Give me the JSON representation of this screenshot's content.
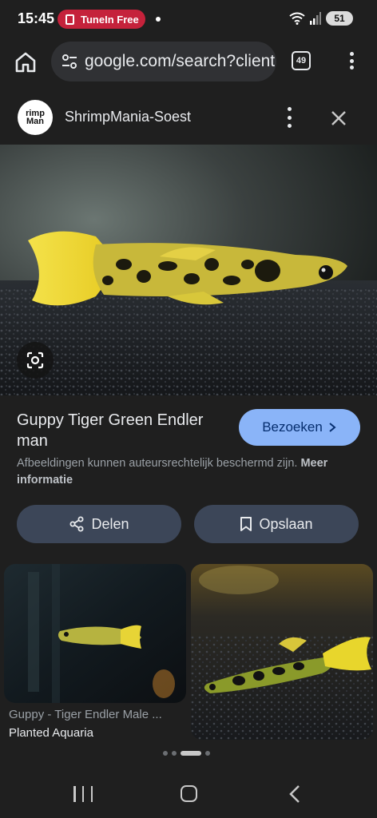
{
  "status_bar": {
    "time": "15:45",
    "recording_pill": "TuneIn Free",
    "battery": "51"
  },
  "browser": {
    "url": "google.com/search?client",
    "tab_count": "49"
  },
  "source": {
    "logo_line1": "rimp",
    "logo_line2": "Man",
    "name": "ShrimpMania-Soest"
  },
  "result": {
    "title": "Guppy Tiger Green Endler man",
    "visit_label": "Bezoeken",
    "disclaimer": "Afbeeldingen kunnen auteursrechtelijk beschermd zijn.",
    "more_info": "Meer informatie",
    "share_label": "Delen",
    "save_label": "Opslaan"
  },
  "related": [
    {
      "caption": "Guppy - Tiger Endler Male ...",
      "source": "Planted Aquaria"
    },
    {
      "caption": "",
      "source": ""
    }
  ],
  "colors": {
    "background": "#1f1f1f",
    "accent": "#8ab4f8",
    "action_button": "#3c4658",
    "record_pill": "#c5223b"
  }
}
